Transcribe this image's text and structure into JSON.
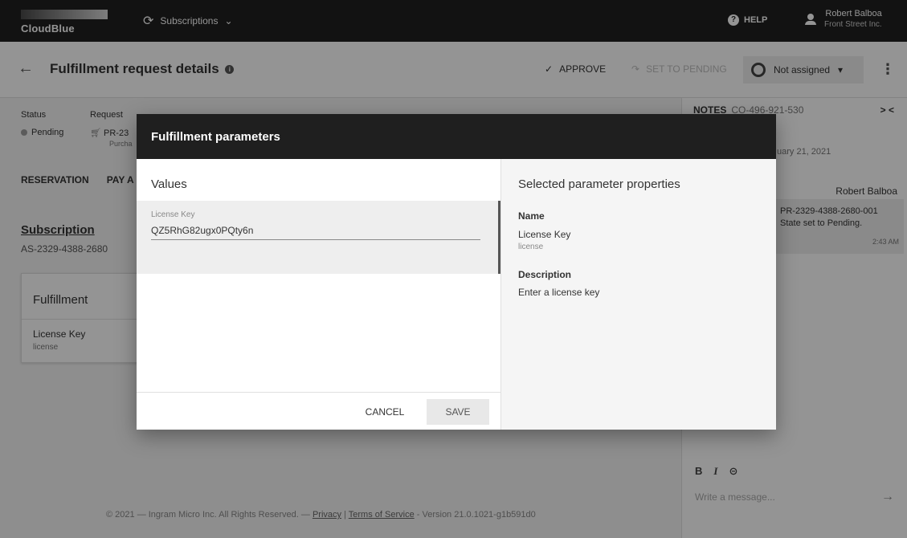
{
  "topbar": {
    "logo_text": "CloudBlue",
    "module_name": "Subscriptions",
    "help_label": "HELP",
    "user_name": "Robert Balboa",
    "user_company": "Front Street Inc."
  },
  "header": {
    "title": "Fulfillment request details",
    "approve_label": "APPROVE",
    "set_pending_label": "SET TO PENDING",
    "assignee": "Not assigned"
  },
  "details": {
    "status_label": "Status",
    "status_value": "Pending",
    "request_label": "Request",
    "request_id": "PR-23",
    "request_type": "Purcha"
  },
  "tabs": [
    "RESERVATION",
    "PAY A"
  ],
  "subscription": {
    "title": "Subscription",
    "id": "AS-2329-4388-2680"
  },
  "fulfillment_card": {
    "title": "Fulfillment",
    "param_name": "License Key",
    "param_id": "license"
  },
  "footer": {
    "copyright": "© 2021 — Ingram Micro Inc. All Rights Reserved. —",
    "privacy": "Privacy",
    "sep": "|",
    "terms": "Terms of Service",
    "version": "- Version 21.0.1021-g1b591d0"
  },
  "notes": {
    "title": "NOTES",
    "ref": "CO-496-921-530",
    "collapse": "> <",
    "date": "uary 21, 2021",
    "author": "Robert Balboa",
    "message_line1": "PR-2329-4388-2680-001",
    "message_line2": "State set to Pending.",
    "time": "2:43 AM",
    "placeholder": "Write a message..."
  },
  "dialog": {
    "title": "Fulfillment parameters",
    "values_title": "Values",
    "field_label": "License Key",
    "field_value": "QZ5RhG82ugx0PQty6n",
    "cancel_label": "CANCEL",
    "save_label": "SAVE",
    "props_title": "Selected parameter properties",
    "name_label": "Name",
    "name_value": "License Key",
    "name_id": "license",
    "desc_label": "Description",
    "desc_value": "Enter a license key"
  }
}
